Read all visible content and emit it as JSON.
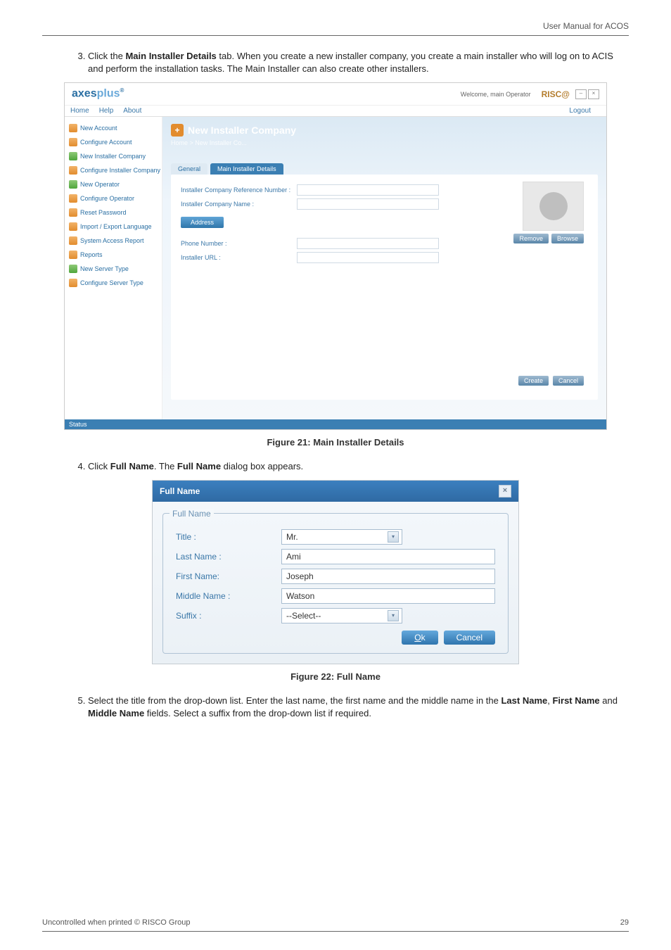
{
  "page": {
    "header_right": "User Manual for ACOS",
    "footer_left": "Uncontrolled when printed © RISCO Group",
    "footer_right": "29"
  },
  "steps": {
    "s3": "Click the ",
    "s3a": "Main Installer Details",
    "s3b": " tab. When you create a new installer company, you create a main installer who will log on to ACIS and perform the installation tasks. The Main Installer can also create other installers.",
    "s4": "Click ",
    "s4a": "Full Name",
    "s4b": ". The ",
    "s4c": "Full Name",
    "s4d": " dialog box appears.",
    "s5a": "Select the title from the drop-down list. Enter the last name, the first name and the middle name in the ",
    "s5b": "Last Name",
    "s5c": ", ",
    "s5d": "First Name",
    "s5e": " and ",
    "s5f": "Middle Name",
    "s5g": " fields. Select a suffix from the drop-down list if required."
  },
  "captions": {
    "fig21": "Figure 21: Main Installer Details",
    "fig22": "Figure 22: Full Name"
  },
  "shot1": {
    "brand_a": "axes",
    "brand_b": "plus",
    "tm": "®",
    "welcome": "Welcome, main Operator",
    "risco": "RISC@",
    "logout": "Logout",
    "menubar": {
      "home": "Home",
      "help": "Help",
      "about": "About"
    },
    "sidebar": [
      "New Account",
      "Configure Account",
      "New Installer Company",
      "Configure Installer Company",
      "New Operator",
      "Configure Operator",
      "Reset Password",
      "Import / Export Language",
      "System Access Report",
      "Reports",
      "New Server Type",
      "Configure Server Type"
    ],
    "banner_title": "New Installer Company",
    "crumb": "Home  >  New Installer Co...",
    "tab_general": "General",
    "tab_main": "Main Installer Details",
    "labels": {
      "refnum": "Installer Company Reference Number :",
      "name": "Installer Company Name :",
      "address": "Address",
      "phone": "Phone Number :",
      "url": "Installer URL :"
    },
    "btn_remove": "Remove",
    "btn_browse": "Browse",
    "btn_create": "Create",
    "btn_cancel": "Cancel",
    "status": "Status"
  },
  "shot2": {
    "title": "Full Name",
    "legend": "Full Name",
    "labels": {
      "title": "Title :",
      "last": "Last Name :",
      "first": "First Name:",
      "middle": "Middle Name :",
      "suffix": "Suffix :"
    },
    "values": {
      "title": "Mr.",
      "last": "Ami",
      "first": "Joseph",
      "middle": "Watson",
      "suffix": "--Select--"
    },
    "btn_ok": "Ok",
    "btn_cancel": "Cancel"
  }
}
